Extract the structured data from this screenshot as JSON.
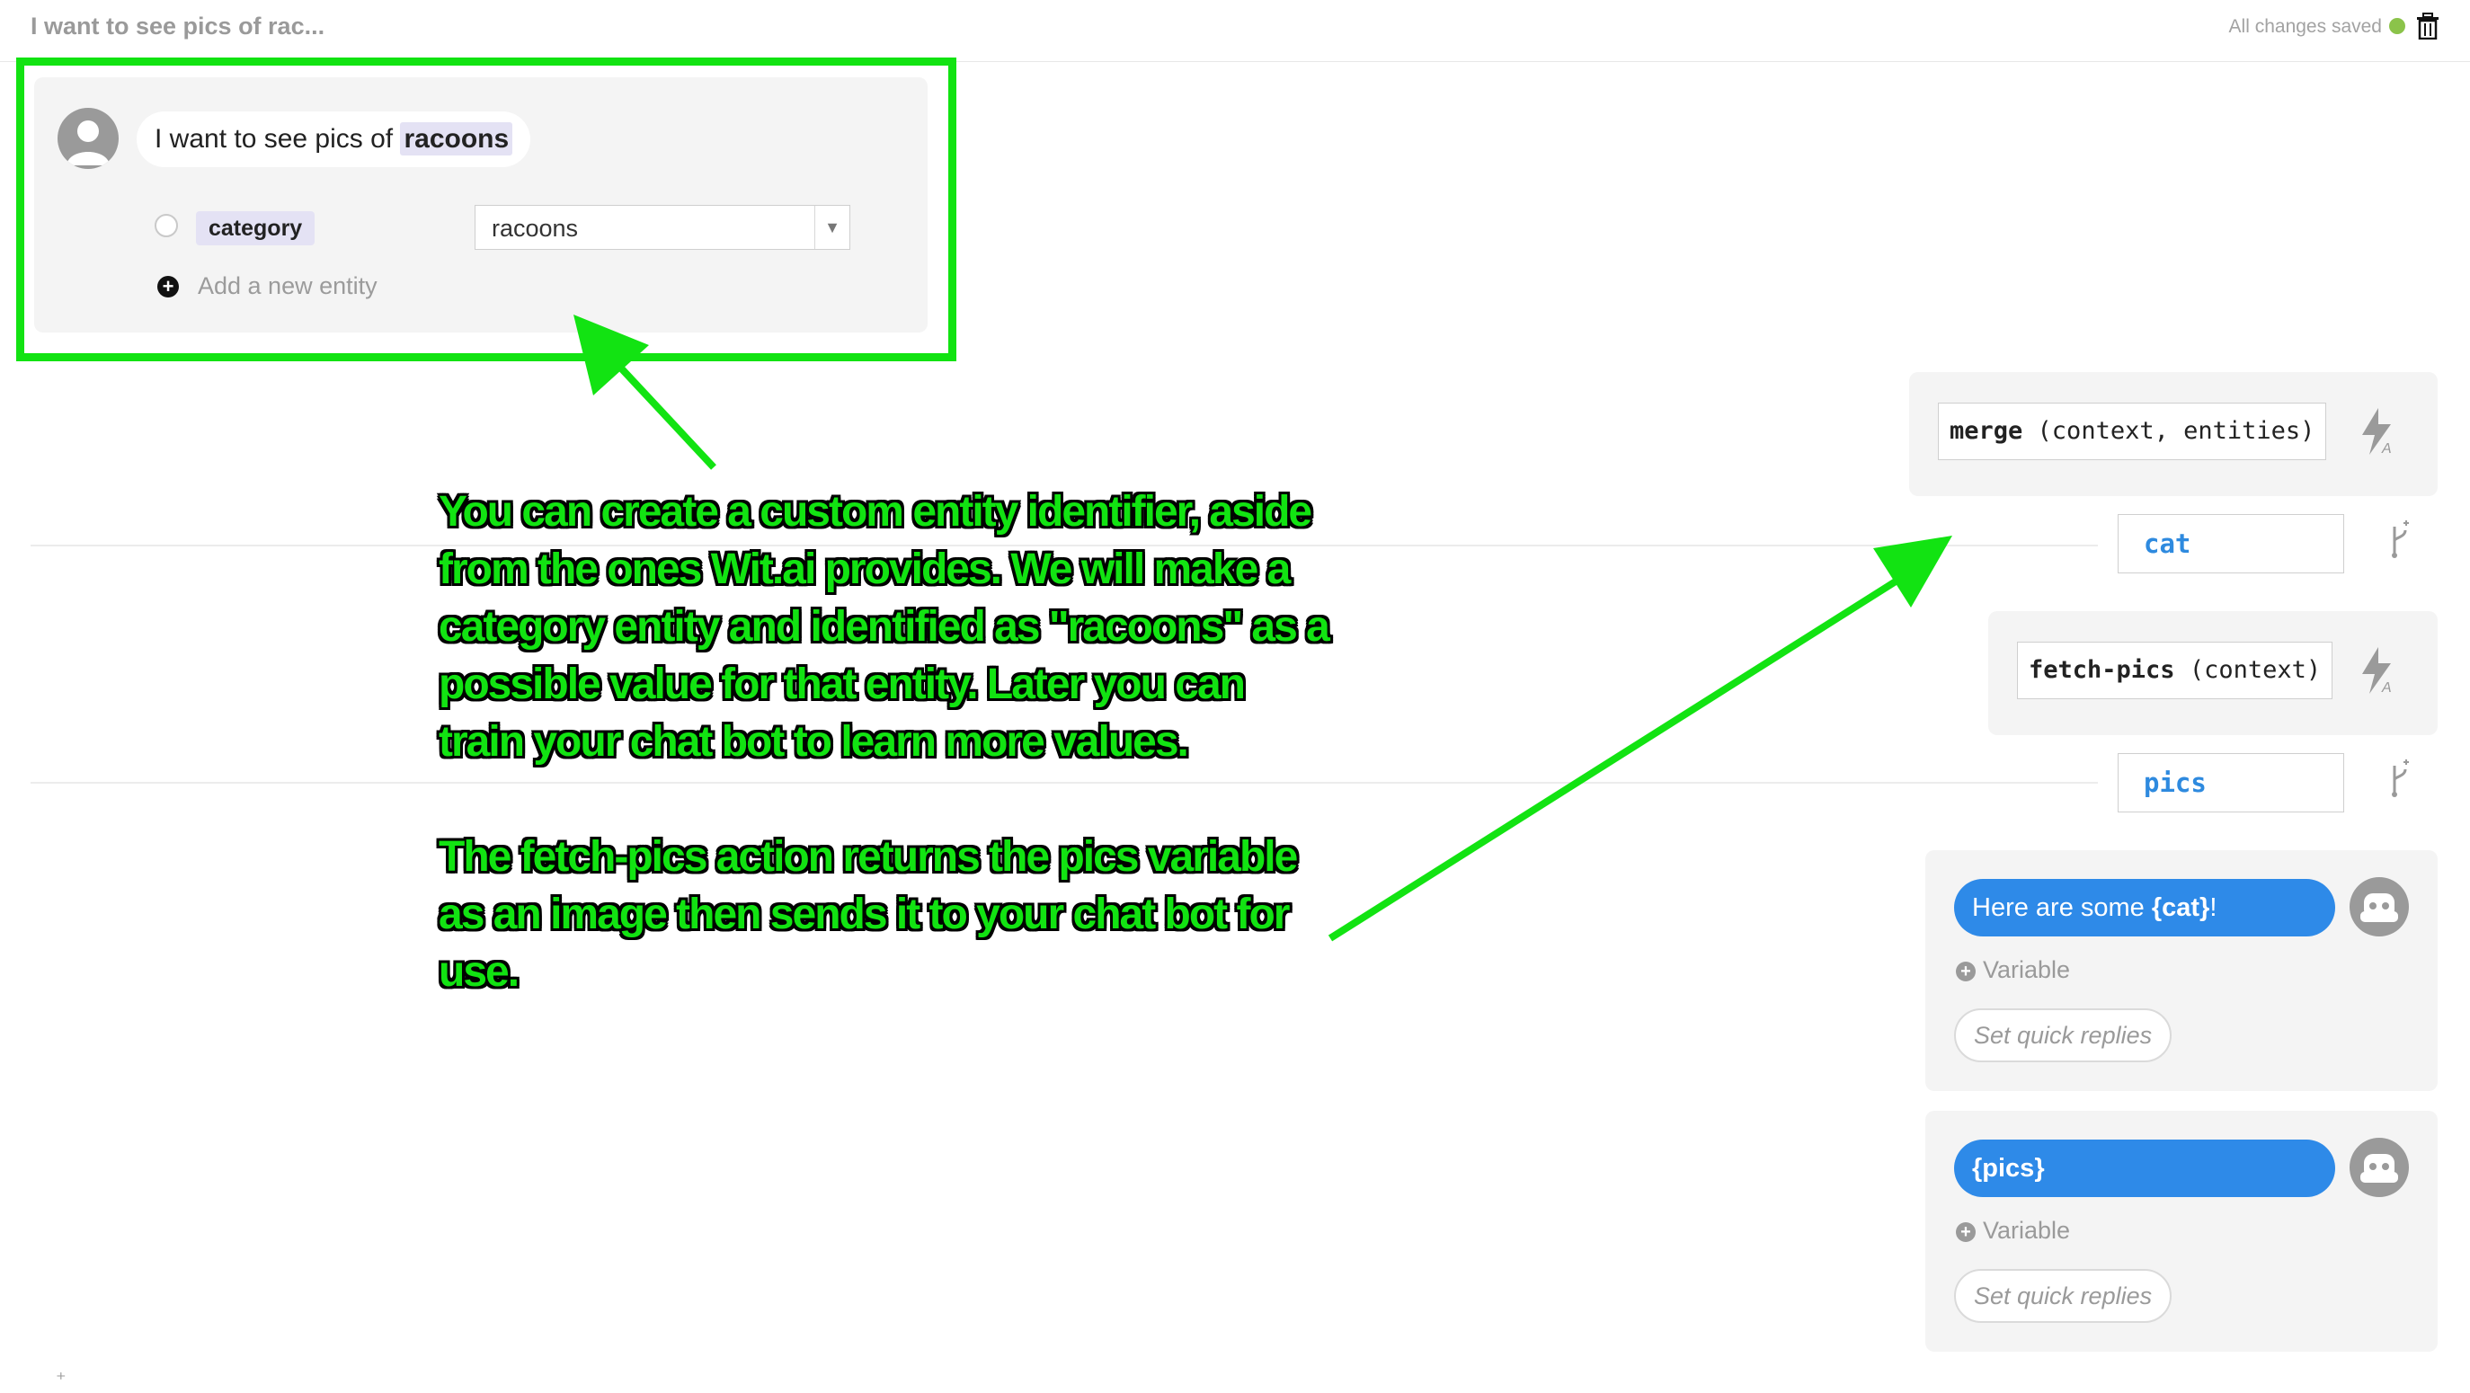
{
  "header": {
    "story_title": "I want to see pics of rac...",
    "save_status": "All changes saved",
    "status_color": "#8bc34a",
    "trash_icon": "trash-icon"
  },
  "user_turn": {
    "message_prefix": "I want to see pics of ",
    "message_highlight": "racoons",
    "entity": {
      "name": "category",
      "value": "racoons"
    },
    "add_entity_label": "Add a new entity"
  },
  "actions": [
    {
      "name": "merge",
      "args": "(context, entities)",
      "variable": "cat"
    },
    {
      "name": "fetch-pics",
      "args": "(context)",
      "variable": "pics"
    }
  ],
  "bot_responses": [
    {
      "prefix": "Here are some ",
      "variable": "{cat}",
      "suffix": "!",
      "var_link": "Variable",
      "quick_replies": "Set quick replies"
    },
    {
      "prefix": "",
      "variable": "{pics}",
      "suffix": "",
      "var_link": "Variable",
      "quick_replies": "Set quick replies"
    }
  ],
  "annotation": {
    "paragraph1": "You can create a custom entity identifier, aside from the ones Wit.ai provides. We will make a category entity and identified as \"racoons\" as a possible value for that entity. Later you can train your chat bot to learn more values.",
    "paragraph2": "The fetch-pics action returns the pics variable as an image then sends it to your chat bot for use.",
    "color": "#12e312"
  },
  "colors": {
    "accent_blue": "#2e8ae8",
    "variable_blue": "#2e8adf",
    "entity_highlight": "#e4e2f4"
  }
}
